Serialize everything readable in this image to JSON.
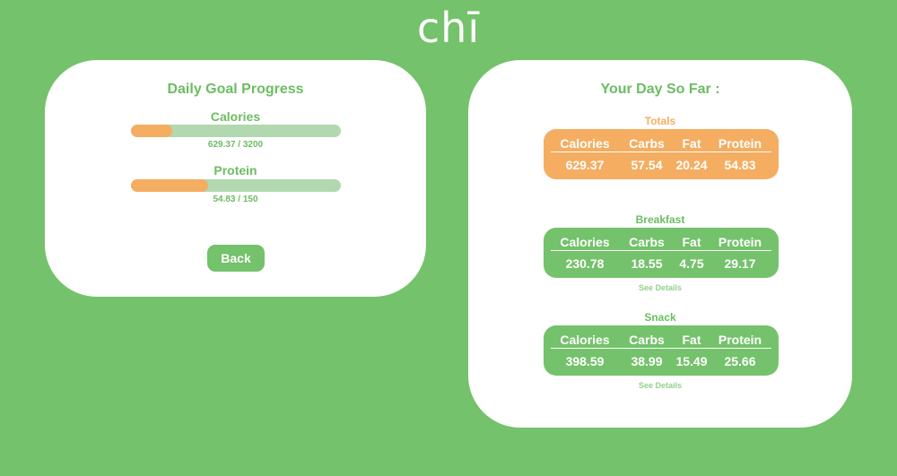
{
  "app": {
    "logo": "chī"
  },
  "goal_card": {
    "title": "Daily Goal Progress",
    "calories": {
      "label": "Calories",
      "value_text": "629.37 / 3200",
      "progress": 0.197
    },
    "protein": {
      "label": "Protein",
      "value_text": "54.83 / 150",
      "progress": 0.366
    },
    "back_label": "Back"
  },
  "day_card": {
    "title": "Your Day So Far :",
    "columns": [
      "Calories",
      "Carbs",
      "Fat",
      "Protein"
    ],
    "totals": {
      "label": "Totals",
      "values": [
        "629.37",
        "57.54",
        "20.24",
        "54.83"
      ]
    },
    "breakfast": {
      "label": "Breakfast",
      "values": [
        "230.78",
        "18.55",
        "4.75",
        "29.17"
      ],
      "details_label": "See Details"
    },
    "snack": {
      "label": "Snack",
      "values": [
        "398.59",
        "38.99",
        "15.49",
        "25.66"
      ],
      "details_label": "See Details"
    }
  },
  "colors": {
    "background": "#74c26b",
    "accent_orange": "#f4ad61",
    "track": "#b2d8b0",
    "card": "#ffffff"
  }
}
